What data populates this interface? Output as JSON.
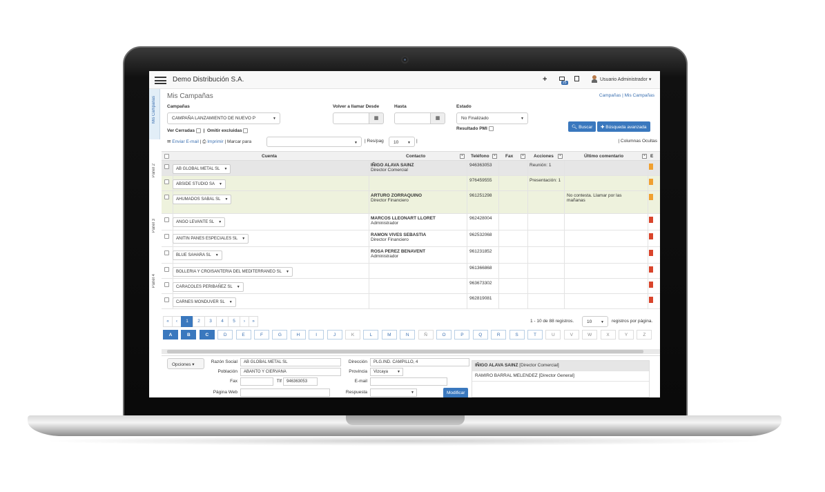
{
  "app": {
    "title": "Demo Distribución S.A.",
    "user": "Usuario Administrador",
    "mail_badge": "25"
  },
  "page": {
    "title": "Mis Campañas",
    "breadcrumb": "Campañas | Mis Campañas",
    "side_tab": "Mis Campañas"
  },
  "filters": {
    "campaign_label": "Campañas",
    "campaign_value": "CAMPAÑA LANZAMIENTO DE NUEVO P",
    "recall_from_label": "Volver a llamar Desde",
    "to_label": "Hasta",
    "state_label": "Estado",
    "state_value": "No Finalizado",
    "closed_label": "Ver Cerradas",
    "exclude_label": "Omitir excluidas",
    "pmi_label": "Resultado PMI",
    "search_button": "Buscar",
    "advanced_button": "Búsqueda avanzada"
  },
  "toolbar": {
    "email": "Enviar E-mail",
    "print": "Imprimir",
    "mark": "Marcar para",
    "per_page_label": "Res/pag",
    "per_page": "10",
    "hidden_cols": "| Columnas Ocultas"
  },
  "columns": {
    "account": "Cuenta",
    "contact": "Contacto",
    "phone": "Teléfono",
    "fax": "Fax",
    "actions": "Acciones",
    "comment": "Último comentario",
    "extra": "E"
  },
  "panels": [
    "Panel 2",
    "Panel 3",
    "Panel 4"
  ],
  "colors": {
    "accent": "#3a78be",
    "selected_row": "#e6e6e6",
    "highlight_row": "#eef2dd",
    "orange": "#f0a030",
    "red": "#d9442b"
  },
  "rows": [
    {
      "account": "AB GLOBAL METAL SL",
      "contact": "IÑIGO ALAVA SAINZ",
      "role": "Director Comercial",
      "phone": "946363053",
      "actions": "Reunión: 1",
      "comment": "",
      "comment2": "",
      "flag": "orange"
    },
    {
      "account": "ABSIDE STUDIO SA",
      "contact": "",
      "role": "",
      "phone": "976459555",
      "actions": "Presentación: 1",
      "comment": "",
      "comment2": "",
      "flag": "orange"
    },
    {
      "account": "AHUMADOS SABAL SL",
      "contact": "ARTURO ZORRAQUINO",
      "role": "Director Financiero",
      "phone": "961251298",
      "actions": "",
      "comment": "No contesta. Llamar por las",
      "comment2": "mañanas",
      "flag": "orange"
    },
    {
      "account": "ANGO LEVANTE SL",
      "contact": "MARCOS LLEONART LLORET",
      "role": "Administrador",
      "phone": "962428004",
      "actions": "",
      "comment": "",
      "comment2": "",
      "flag": "red"
    },
    {
      "account": "ANITIN PANES ESPECIALES SL",
      "contact": "RAMON VIVES SEBASTIA",
      "role": "Director Financiero",
      "phone": "962532068",
      "actions": "",
      "comment": "",
      "comment2": "",
      "flag": "red"
    },
    {
      "account": "BLUE SAHARA SL",
      "contact": "ROSA PEREZ BENAVENT",
      "role": "Administrador",
      "phone": "961231852",
      "actions": "",
      "comment": "",
      "comment2": "",
      "flag": "red"
    },
    {
      "account": "BOLLERIA Y CROISANTERIA DEL MEDITERRANEO SL",
      "contact": "",
      "role": "",
      "phone": "961366868",
      "actions": "",
      "comment": "",
      "comment2": "",
      "flag": "red"
    },
    {
      "account": "CARACOLES PERIBAÑEZ SL",
      "contact": "",
      "role": "",
      "phone": "963673302",
      "actions": "",
      "comment": "",
      "comment2": "",
      "flag": "red"
    },
    {
      "account": "CARNES MONDUVER SL",
      "contact": "",
      "role": "",
      "phone": "962819081",
      "actions": "",
      "comment": "",
      "comment2": "",
      "flag": "red"
    }
  ],
  "pagination": {
    "first": "«",
    "prev": "‹",
    "pages": [
      "1",
      "2",
      "3",
      "4",
      "5"
    ],
    "next": "›",
    "last": "»",
    "current": "1",
    "summary": "1 - 10 de 88 registros.",
    "per_page": "10",
    "per_page_suffix": "registros por página."
  },
  "letters": [
    "A",
    "B",
    "C",
    "D",
    "E",
    "F",
    "G",
    "H",
    "I",
    "J",
    "K",
    "L",
    "M",
    "N",
    "Ñ",
    "O",
    "P",
    "Q",
    "R",
    "S",
    "T",
    "U",
    "V",
    "W",
    "X",
    "Y",
    "Z"
  ],
  "detail": {
    "options_button": "Opciones",
    "razon_label": "Razón Social",
    "razon": "AB GLOBAL METAL SL",
    "poblacion_label": "Población",
    "poblacion": "ABANTO Y CIERVANA",
    "fax_label": "Fax",
    "fax": "",
    "tlf_label": "Tlf",
    "tlf": "946363053",
    "web_label": "Página Web",
    "web": "",
    "direccion_label": "Dirección",
    "direccion": "PLG.IND. CAMPILLO, 4",
    "provincia_label": "Provincia",
    "provincia": "Vizcaya",
    "email_label": "E-mail",
    "email": "",
    "respuesta_label": "Respuesta",
    "respuesta": "",
    "modify_button": "Modificar",
    "contacts": [
      {
        "name": "IÑIGO ALAVA SAINZ",
        "role": "[Director Comercial]"
      },
      {
        "name": "RAMIRO BARRAL MELENDEZ",
        "role": "[Director General]"
      }
    ]
  }
}
